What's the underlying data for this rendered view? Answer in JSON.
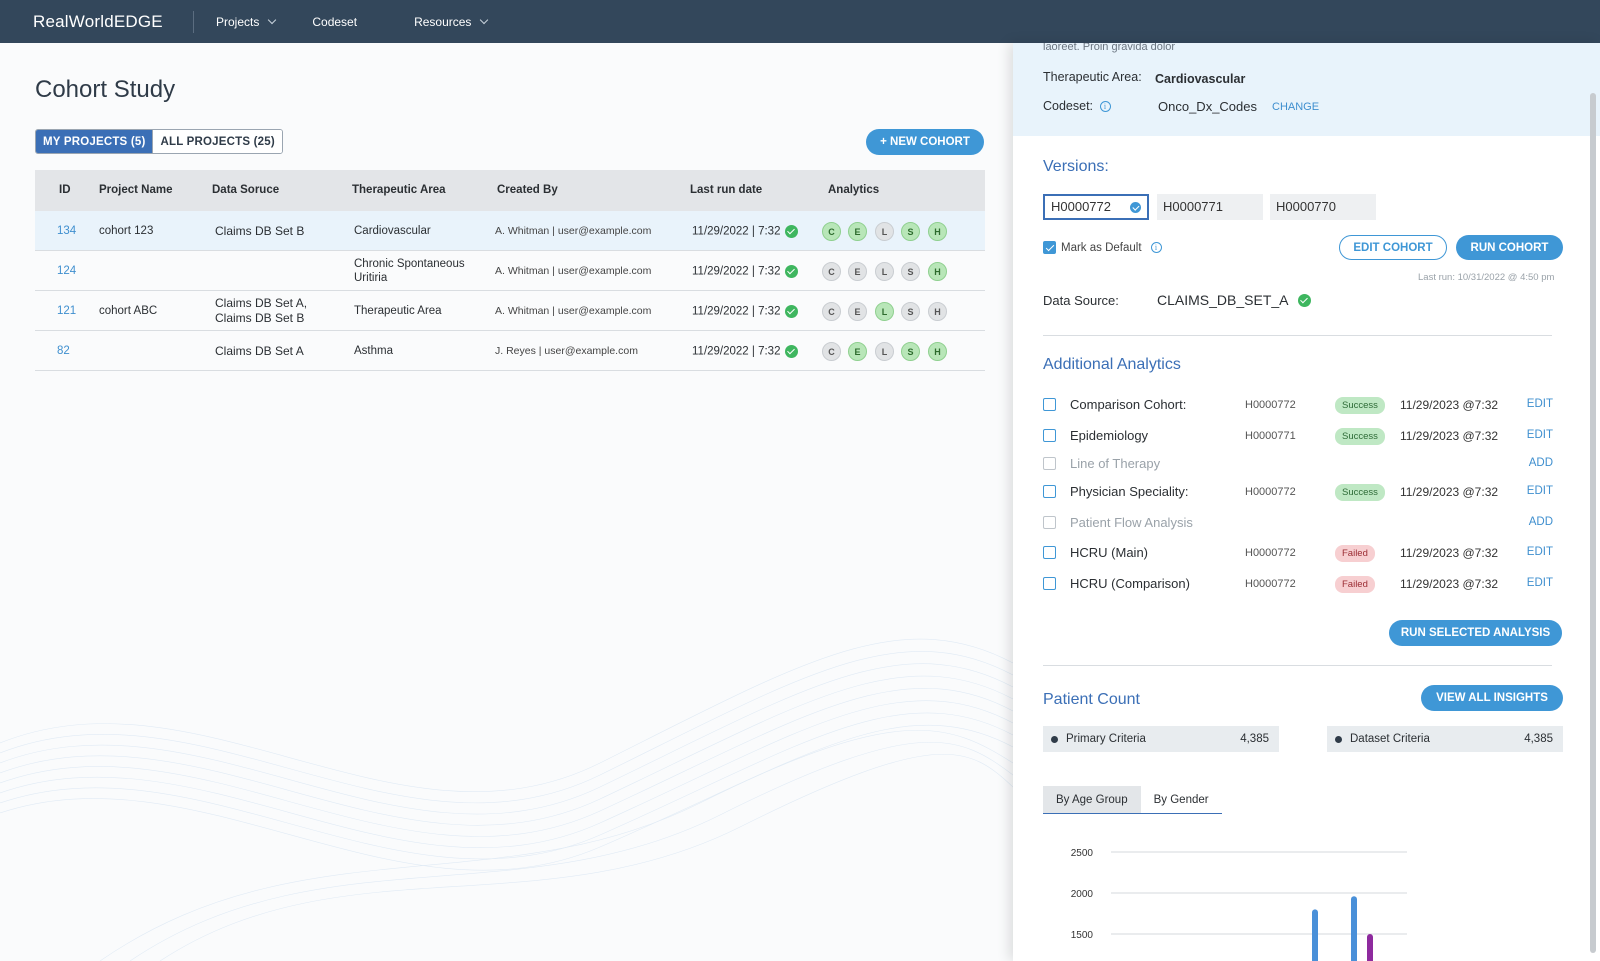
{
  "nav": {
    "brand": "RealWorldEDGE",
    "items": [
      {
        "label": "Projects",
        "dropdown": true
      },
      {
        "label": "Codeset",
        "dropdown": false
      },
      {
        "label": "Resources",
        "dropdown": true
      }
    ]
  },
  "main": {
    "title": "Cohort Study",
    "tabs": [
      "MY PROJECTS (5)",
      "ALL PROJECTS (25)"
    ],
    "new_cohort": "+ NEW COHORT",
    "columns": [
      "ID",
      "Project Name",
      "Data Soruce",
      "Therapeutic Area",
      "Created By",
      "Last run date",
      "Analytics"
    ],
    "rows": [
      {
        "id": "134",
        "name": "cohort 123",
        "source": "Claims DB Set B",
        "area": "Cardiovascular",
        "created": "A. Whitman | user@example.com",
        "date": "11/29/2022 | 7:32",
        "analytics": [
          true,
          true,
          false,
          true,
          true
        ]
      },
      {
        "id": "124",
        "name": "",
        "source": "",
        "area": "Chronic Spontaneous Uritiria",
        "created": "A. Whitman | user@example.com",
        "date": "11/29/2022 | 7:32",
        "analytics": [
          false,
          false,
          false,
          false,
          true
        ]
      },
      {
        "id": "121",
        "name": "cohort ABC",
        "source": "Claims DB Set A, Claims DB Set B",
        "area": "Therapeutic Area",
        "created": "A. Whitman | user@example.com",
        "date": "11/29/2022 | 7:32",
        "analytics": [
          false,
          false,
          true,
          false,
          false
        ]
      },
      {
        "id": "82",
        "name": "",
        "source": "Claims DB Set A",
        "area": "Asthma",
        "created": "J. Reyes | user@example.com",
        "date": "11/29/2022 | 7:32",
        "analytics": [
          false,
          true,
          false,
          true,
          true
        ]
      }
    ],
    "analytic_letters": [
      "C",
      "E",
      "L",
      "S",
      "H"
    ]
  },
  "panel": {
    "desc_tail": "laoreet. Proin gravida dolor",
    "therapeutic_label": "Therapeutic Area:",
    "therapeutic_value": "Cardiovascular",
    "codeset_label": "Codeset:",
    "codeset_value": "Onco_Dx_Codes",
    "change": "CHANGE",
    "versions_title": "Versions:",
    "versions": [
      "H0000772",
      "H0000771",
      "H0000770"
    ],
    "mark_default": "Mark as Default",
    "edit_cohort": "EDIT COHORT",
    "run_cohort": "RUN COHORT",
    "last_run": "Last run: 10/31/2022 @ 4:50 pm",
    "data_source_label": "Data Source:",
    "data_source_value": "CLAIMS_DB_SET_A",
    "additional_title": "Additional Analytics",
    "analytics": [
      {
        "name": "Comparison Cohort:",
        "version": "H0000772",
        "status": "Success",
        "date": "11/29/2023 @7:32",
        "action": "EDIT",
        "enabled": true
      },
      {
        "name": "Epidemiology",
        "version": "H0000771",
        "status": "Success",
        "date": "11/29/2023 @7:32",
        "action": "EDIT",
        "enabled": true
      },
      {
        "name": "Line of Therapy",
        "version": "",
        "status": "",
        "date": "",
        "action": "ADD",
        "enabled": false
      },
      {
        "name": "Physician Speciality:",
        "version": "H0000772",
        "status": "Success",
        "date": "11/29/2023 @7:32",
        "action": "EDIT",
        "enabled": true
      },
      {
        "name": "Patient Flow Analysis",
        "version": "",
        "status": "",
        "date": "",
        "action": "ADD",
        "enabled": false
      },
      {
        "name": "HCRU (Main)",
        "version": "H0000772",
        "status": "Failed",
        "date": "11/29/2023 @7:32",
        "action": "EDIT",
        "enabled": true
      },
      {
        "name": "HCRU (Comparison)",
        "version": "H0000772",
        "status": "Failed",
        "date": "11/29/2023 @7:32",
        "action": "EDIT",
        "enabled": true
      }
    ],
    "run_selected": "RUN SELECTED ANALYSIS",
    "patient_count_title": "Patient Count",
    "view_all": "VIEW ALL INSIGHTS",
    "criteria": [
      {
        "label": "Primary Criteria",
        "value": "4,385"
      },
      {
        "label": "Dataset Criteria",
        "value": "4,385"
      }
    ],
    "chart_tabs": [
      "By Age Group",
      "By Gender"
    ]
  },
  "chart_data": {
    "type": "bar",
    "yticks": [
      "2500",
      "2000",
      "1500"
    ],
    "ylim": [
      1500,
      2500
    ],
    "bars": [
      {
        "value": 1800,
        "color": "#4a90d9"
      },
      {
        "value": 1960,
        "color": "#4a90d9"
      },
      {
        "value": 1500,
        "color": "#8e2a9e"
      }
    ]
  },
  "colors": {
    "accent": "#3f97d6",
    "nav": "#33475b",
    "success": "#3eb65f",
    "failed": "#9b2c33"
  }
}
